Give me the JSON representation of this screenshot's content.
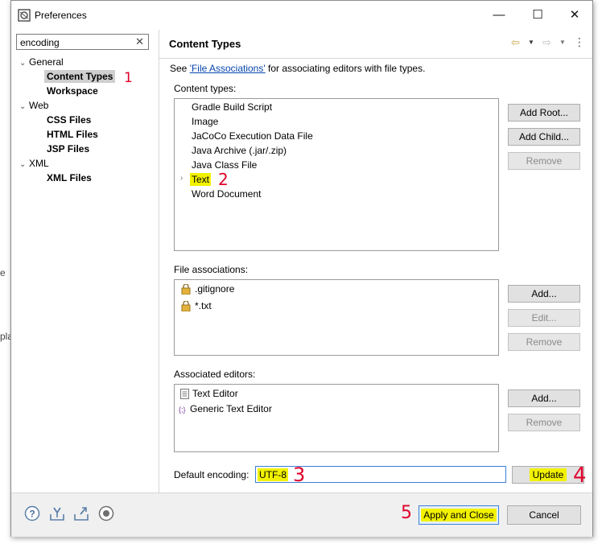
{
  "window": {
    "title": "Preferences",
    "minimize": "—",
    "maximize": "☐",
    "close": "✕"
  },
  "edge_fragments": [
    "e",
    "pla"
  ],
  "sidebar": {
    "filter_value": "encoding",
    "clear_glyph": "✕",
    "tree": {
      "general": "General",
      "content_types": "Content Types",
      "workspace": "Workspace",
      "web": "Web",
      "css_files": "CSS Files",
      "html_files": "HTML Files",
      "jsp_files": "JSP Files",
      "xml": "XML",
      "xml_files": "XML Files"
    }
  },
  "page": {
    "title": "Content Types",
    "description_prefix": "See ",
    "description_link": "'File Associations'",
    "description_suffix": " for associating editors with file types.",
    "content_types_label": "Content types:",
    "content_types": [
      "Gradle Build Script",
      "Image",
      "JaCoCo Execution Data File",
      "Java Archive (.jar/.zip)",
      "Java Class File",
      "Text",
      "Word Document"
    ],
    "add_root": "Add Root...",
    "add_child": "Add Child...",
    "remove": "Remove",
    "file_associations_label": "File associations:",
    "file_associations": [
      ".gitignore",
      "*.txt"
    ],
    "add": "Add...",
    "edit": "Edit...",
    "associated_editors_label": "Associated editors:",
    "associated_editors": [
      "Text Editor",
      "Generic Text Editor"
    ],
    "default_encoding_label": "Default encoding:",
    "default_encoding_value": "UTF-8",
    "update": "Update"
  },
  "footer": {
    "apply_and_close": "Apply and Close",
    "cancel": "Cancel"
  },
  "annotations": {
    "n1": "1",
    "n2": "2",
    "n3": "3",
    "n4": "4",
    "n5": "5"
  },
  "colors": {
    "highlight": "#f2f200",
    "annotation": "#e0002a",
    "focus": "#3c7fd8"
  }
}
